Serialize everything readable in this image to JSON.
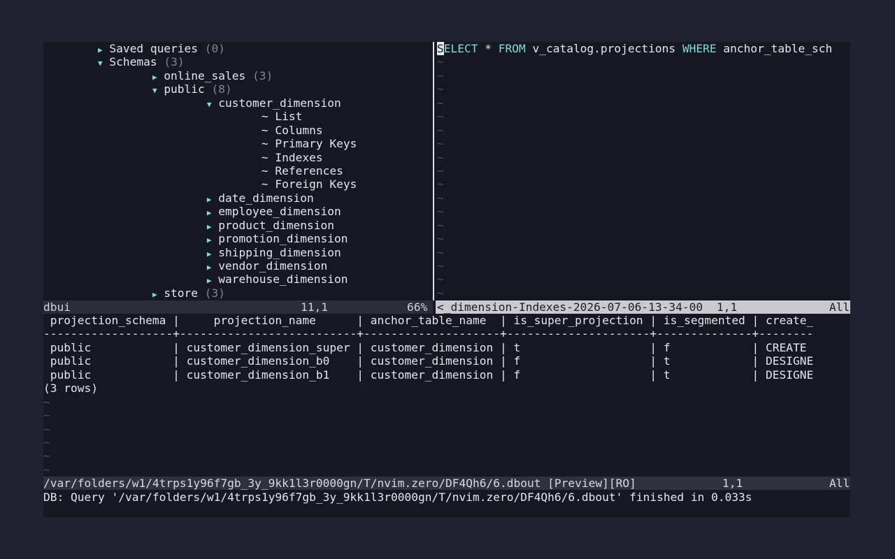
{
  "tree": {
    "saved_queries": {
      "label": "Saved queries",
      "count": "(0)"
    },
    "schemas": {
      "label": "Schemas",
      "count": "(3)"
    },
    "online_sales": {
      "label": "online_sales",
      "count": "(3)"
    },
    "public": {
      "label": "public",
      "count": "(8)"
    },
    "customer_dimension": {
      "label": "customer_dimension"
    },
    "actions": [
      "~ List",
      "~ Columns",
      "~ Primary Keys",
      "~ Indexes",
      "~ References",
      "~ Foreign Keys"
    ],
    "tables": [
      "date_dimension",
      "employee_dimension",
      "product_dimension",
      "promotion_dimension",
      "shipping_dimension",
      "vendor_dimension",
      "warehouse_dimension"
    ],
    "store": {
      "label": "store",
      "count": "(3)"
    }
  },
  "editor": {
    "cursor_char": "S",
    "kw_select": "ELECT",
    "star": " * ",
    "kw_from": "FROM",
    "table": " v_catalog.projections ",
    "kw_where": "WHERE",
    "rest": " anchor_table_sch",
    "tilde": "~"
  },
  "status_top": {
    "left_name": "dbui",
    "left_pos": "11,1",
    "left_pct": "66%",
    "right_name": "<_dimension-Indexes-2026-07-06-13-34-00",
    "right_pos": "1,1",
    "right_all": "All"
  },
  "results": {
    "header": " projection_schema |     projection_name      | anchor_table_name  | is_super_projection | is_segmented | create_",
    "separator": "-------------------+--------------------------+--------------------+---------------------+--------------+--------",
    "rows": [
      " public            | customer_dimension_super | customer_dimension | t                   | f            | CREATE",
      " public            | customer_dimension_b0    | customer_dimension | f                   | t            | DESIGNE",
      " public            | customer_dimension_b1    | customer_dimension | f                   | t            | DESIGNE"
    ],
    "row_count": "(3 rows)",
    "tilde": "~"
  },
  "status_bottom": {
    "file": "/var/folders/w1/4trps1y96f7gb_3y_9kk1l3r0000gn/T/nvim.zero/DF4Qh6/6.dbout [Preview][RO]",
    "pos": "1,1",
    "all": "All"
  },
  "message": "DB: Query '/var/folders/w1/4trps1y96f7gb_3y_9kk1l3r0000gn/T/nvim.zero/DF4Qh6/6.dbout' finished in 0.033s",
  "colors": {
    "accent": "#7cdcd9",
    "background": "#161821",
    "statusbar_active": "#c9c9cf"
  }
}
